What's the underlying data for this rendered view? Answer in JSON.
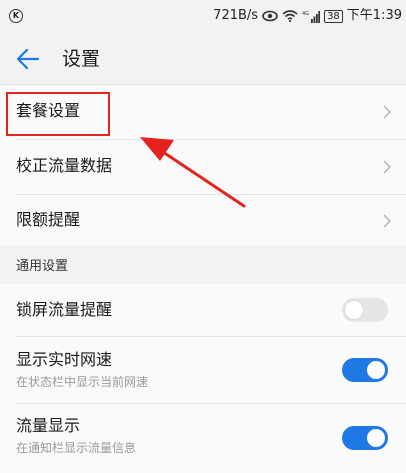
{
  "status_bar": {
    "net_speed": "721B/s",
    "battery": "38",
    "time": "下午1:39",
    "icons": [
      "k-circle-icon",
      "eye-icon",
      "wifi-icon",
      "signal-icon",
      "battery-icon"
    ]
  },
  "app_bar": {
    "title": "设置",
    "back_icon": "back-arrow-icon"
  },
  "main_items": [
    {
      "label": "套餐设置"
    },
    {
      "label": "校正流量数据"
    },
    {
      "label": "限额提醒"
    }
  ],
  "general": {
    "section_title": "通用设置",
    "items": [
      {
        "label": "锁屏流量提醒",
        "sub": "",
        "toggle": false
      },
      {
        "label": "显示实时网速",
        "sub": "在状态栏中显示当前网速",
        "toggle": true
      },
      {
        "label": "流量显示",
        "sub": "在通知栏显示流量信息",
        "toggle": true
      }
    ]
  },
  "colors": {
    "accent": "#1e78e6",
    "annotation": "#e4231f",
    "background": "#f2f2f2"
  }
}
